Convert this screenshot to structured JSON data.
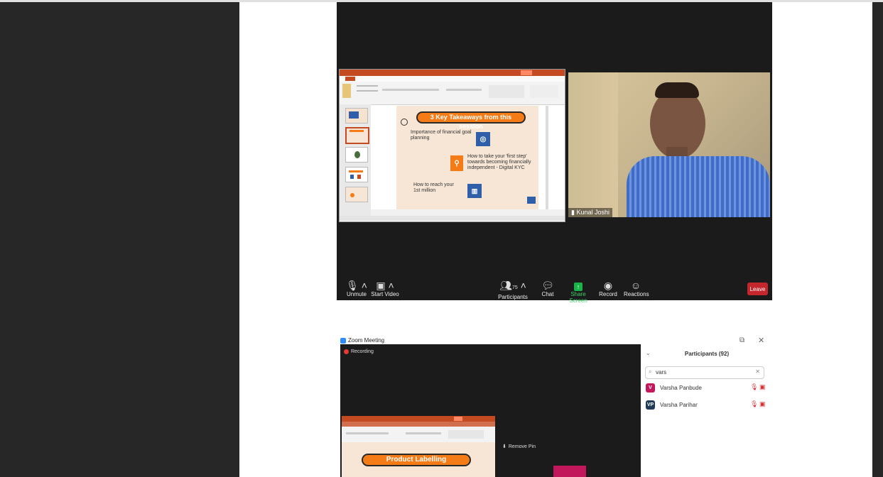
{
  "zoom_top": {
    "ppt_banner": "3 Key Takeaways from this session",
    "slide_items": [
      "Importance of financial goal planning",
      "How to take your 'first step' towards becoming financially independent - Digital KYC",
      "How to reach your 1st million"
    ],
    "participant_name": "Kunal Joshi",
    "toolbar": {
      "unmute": "Unmute",
      "start_video": "Start Video",
      "participants_count": "75",
      "participants": "Participants",
      "chat": "Chat",
      "share_screen": "Share Screen",
      "record": "Record",
      "reactions": "Reactions",
      "leave": "Leave"
    }
  },
  "zoom_bottom": {
    "window_title": "Zoom Meeting",
    "recording": "Recording",
    "remove_pin": "Remove Pin",
    "ppt_banner": "Product Labelling",
    "participants_title": "Participants (92)",
    "search_value": "vars",
    "participants": [
      {
        "initials": "V",
        "name": "Varsha Panbude",
        "color": "#c2185b"
      },
      {
        "initials": "VP",
        "name": "Varsha Parihar",
        "color": "#1f3b57"
      }
    ]
  },
  "colors": {
    "accent_orange": "#f47b16",
    "leave_red": "#c3262d",
    "share_green": "#19b34a"
  }
}
